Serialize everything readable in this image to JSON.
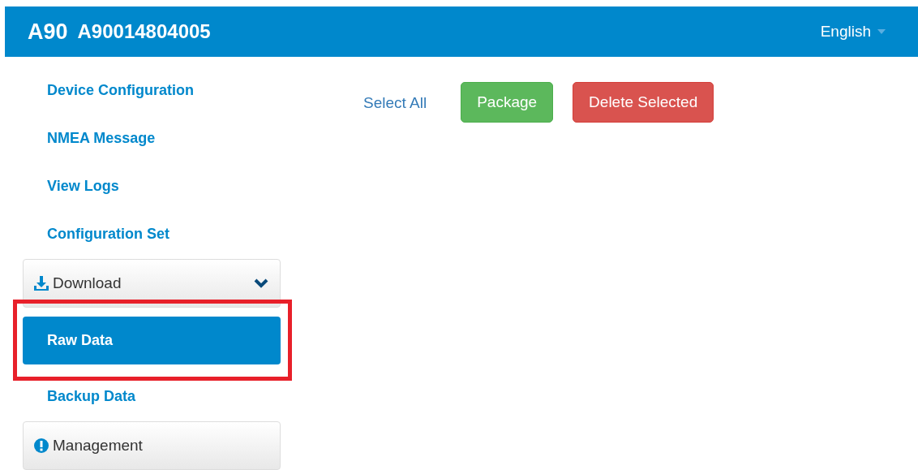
{
  "header": {
    "model": "A90",
    "serial": "A90014804005",
    "language": "English"
  },
  "sidebar": {
    "items": [
      {
        "kind": "link",
        "label": "Device Configuration",
        "selected": false
      },
      {
        "kind": "link",
        "label": "NMEA Message",
        "selected": false
      },
      {
        "kind": "link",
        "label": "View Logs",
        "selected": false
      },
      {
        "kind": "link",
        "label": "Configuration Set",
        "selected": false
      },
      {
        "kind": "panel",
        "label": "Download",
        "expanded": true,
        "children": [
          {
            "label": "Raw Data",
            "selected": true,
            "highlighted": true
          },
          {
            "label": "Backup Data",
            "selected": false,
            "highlighted": false
          }
        ]
      },
      {
        "kind": "panel",
        "label": "Management",
        "expanded": false
      }
    ]
  },
  "toolbar": {
    "select_all": "Select All",
    "buttons": [
      {
        "kind": "success",
        "label": "Package"
      },
      {
        "kind": "danger",
        "label": "Delete Selected"
      }
    ]
  }
}
